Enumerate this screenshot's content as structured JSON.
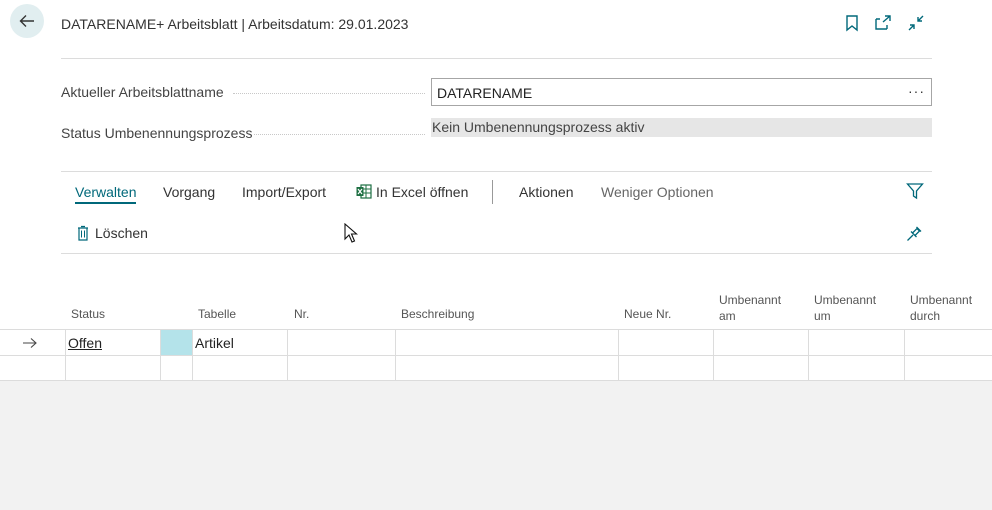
{
  "header": {
    "title": "DATARENAME+ Arbeitsblatt | Arbeitsdatum: 29.01.2023"
  },
  "fields": {
    "worksheet_name_label": "Aktueller Arbeitsblattname",
    "worksheet_name_value": "DATARENAME",
    "more_label": "···",
    "status_label": "Status Umbenennungsprozess",
    "status_value": "Kein Umbenennungsprozess aktiv"
  },
  "actions": {
    "tabs": [
      "Verwalten",
      "Vorgang",
      "Import/Export",
      "In Excel öffnen",
      "Aktionen",
      "Weniger Optionen"
    ],
    "delete_label": "Löschen"
  },
  "grid": {
    "columns": {
      "status": "Status",
      "tabelle": "Tabelle",
      "nr": "Nr.",
      "beschreibung": "Beschreibung",
      "neue_nr": "Neue Nr.",
      "umbenannt_am": [
        "Umbenannt",
        "am"
      ],
      "umbenannt_um": [
        "Umbenannt",
        "um"
      ],
      "umbenannt_durch": [
        "Umbenannt",
        "durch"
      ]
    },
    "rows": [
      {
        "status": "Offen",
        "tabelle": "Artikel",
        "nr": "",
        "beschreibung": "",
        "neue_nr": "",
        "am": "",
        "um": "",
        "durch": ""
      }
    ]
  },
  "colors": {
    "accent": "#00687a",
    "selected_cell": "#b4e3ea",
    "back_button_bg": "#e1eef0"
  },
  "icons": [
    "arrow-left-icon",
    "bookmark-icon",
    "open-new-window-icon",
    "collapse-icon",
    "excel-icon",
    "trash-icon",
    "filter-icon",
    "pin-icon",
    "row-arrow-icon",
    "mouse-cursor-icon"
  ]
}
